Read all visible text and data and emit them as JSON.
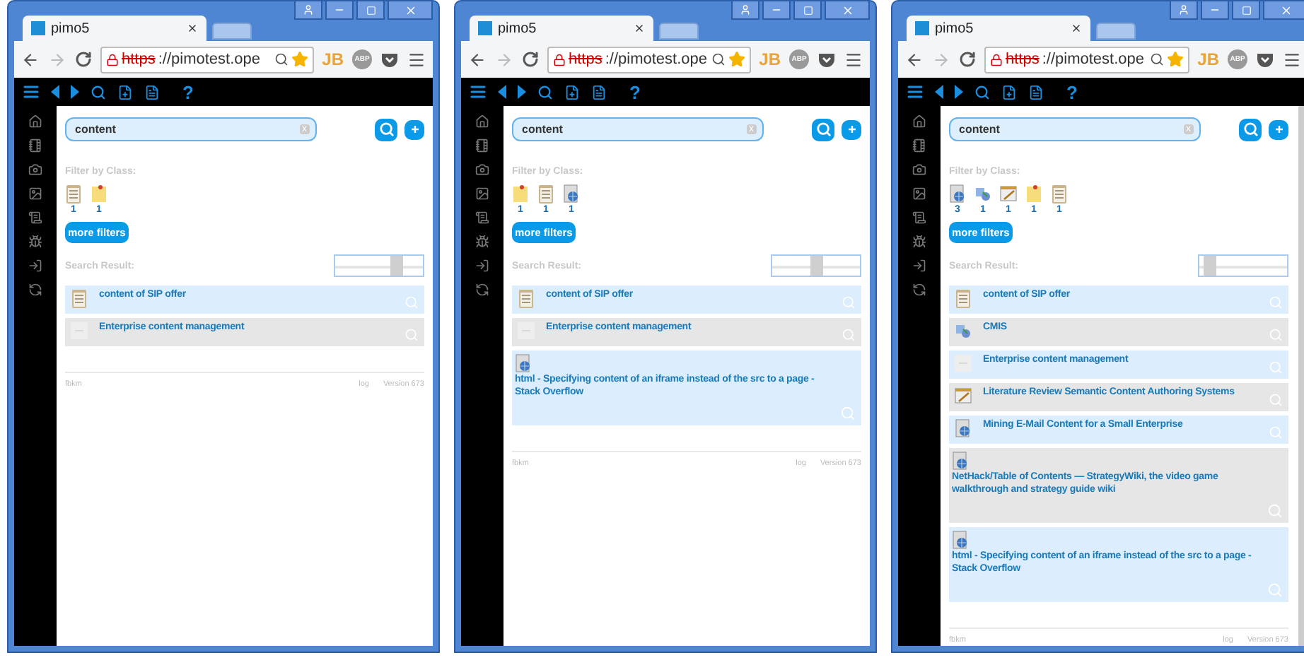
{
  "windows": [
    {
      "tab_title": "pimo5",
      "url_scheme": "https",
      "url_rest": "://pimotest.ope",
      "extensions": [
        "JB",
        "ABP"
      ],
      "help": "?",
      "search": {
        "value": "content",
        "clear": "x"
      },
      "filter_label": "Filter by Class:",
      "filters": [
        {
          "kind": "clipboard",
          "count": "1"
        },
        {
          "kind": "note",
          "count": "1"
        }
      ],
      "more_filters": "more filters",
      "result_label": "Search Result:",
      "slider": {
        "level": 0.74
      },
      "results": [
        {
          "kind": "clipboard",
          "stacked": false,
          "title": "content of SIP offer"
        },
        {
          "kind": "blank",
          "stacked": false,
          "title": "Enterprise content management"
        }
      ],
      "footer": {
        "left": "fbkm",
        "links": [
          "log",
          "Version 673"
        ]
      },
      "scrollbar": false
    },
    {
      "tab_title": "pimo5",
      "url_scheme": "https",
      "url_rest": "://pimotest.ope",
      "extensions": [
        "JB",
        "ABP"
      ],
      "help": "?",
      "search": {
        "value": "content",
        "clear": "x"
      },
      "filter_label": "Filter by Class:",
      "filters": [
        {
          "kind": "note",
          "count": "1"
        },
        {
          "kind": "clipboard",
          "count": "1"
        },
        {
          "kind": "globe",
          "count": "1"
        }
      ],
      "more_filters": "more filters",
      "result_label": "Search Result:",
      "slider": {
        "level": 0.5
      },
      "results": [
        {
          "kind": "clipboard",
          "stacked": false,
          "title": "content of SIP offer"
        },
        {
          "kind": "blank",
          "stacked": false,
          "title": "Enterprise content management"
        },
        {
          "kind": "globe",
          "stacked": true,
          "title": "html - Specifying content of an iframe instead of the src to a page - Stack Overflow"
        }
      ],
      "footer": {
        "left": "fbkm",
        "links": [
          "log",
          "Version 673"
        ]
      },
      "scrollbar": false
    },
    {
      "tab_title": "pimo5",
      "url_scheme": "https",
      "url_rest": "://pimotest.ope",
      "extensions": [
        "JB",
        "ABP"
      ],
      "help": "?",
      "search": {
        "value": "content",
        "clear": "x"
      },
      "filter_label": "Filter by Class:",
      "filters": [
        {
          "kind": "globe",
          "count": "3"
        },
        {
          "kind": "plugin",
          "count": "1"
        },
        {
          "kind": "notebook",
          "count": "1"
        },
        {
          "kind": "note",
          "count": "1"
        },
        {
          "kind": "clipboard",
          "count": "1"
        }
      ],
      "more_filters": "more filters",
      "result_label": "Search Result:",
      "slider": {
        "level": 0.06
      },
      "results": [
        {
          "kind": "clipboard",
          "stacked": false,
          "title": "content of SIP offer"
        },
        {
          "kind": "plugin",
          "stacked": false,
          "title": "CMIS"
        },
        {
          "kind": "blank",
          "stacked": false,
          "title": "Enterprise content management"
        },
        {
          "kind": "notebook",
          "stacked": false,
          "title": "Literature Review Semantic Content Authoring Systems"
        },
        {
          "kind": "globe",
          "stacked": false,
          "title": "Mining E-Mail Content for a Small Enterprise"
        },
        {
          "kind": "globe",
          "stacked": true,
          "title": "NetHack/Table of Contents — StrategyWiki, the video game walkthrough and strategy guide wiki"
        },
        {
          "kind": "globe",
          "stacked": true,
          "title": "html - Specifying content of an iframe instead of the src to a page - Stack Overflow"
        }
      ],
      "footer": {
        "left": "fbkm",
        "links": [
          "log",
          "Version 673"
        ]
      },
      "scrollbar": true
    }
  ]
}
